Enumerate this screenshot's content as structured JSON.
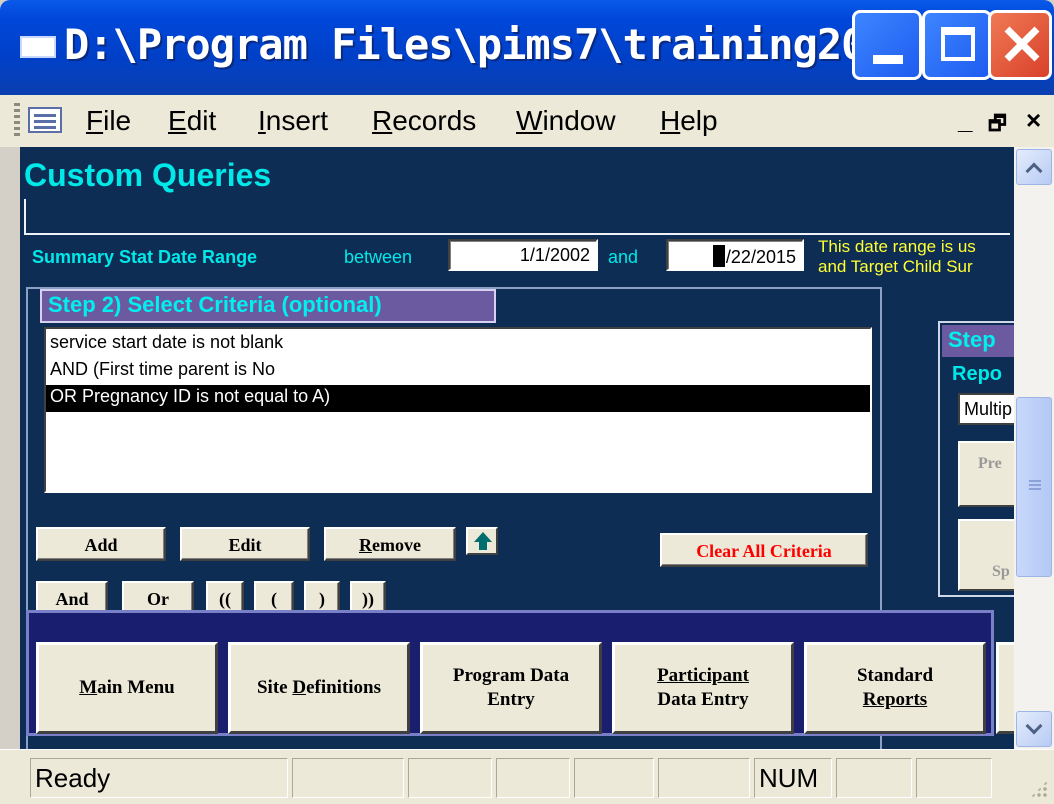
{
  "window": {
    "title": "D:\\Program Files\\pims7\\training20...",
    "buttons": [
      "minimize",
      "maximize",
      "close"
    ]
  },
  "menubar": {
    "items": [
      {
        "label": "File",
        "mnemonic": "F"
      },
      {
        "label": "Edit",
        "mnemonic": "E"
      },
      {
        "label": "Insert",
        "mnemonic": "I"
      },
      {
        "label": "Records",
        "mnemonic": "R"
      },
      {
        "label": "Window",
        "mnemonic": "W"
      },
      {
        "label": "Help",
        "mnemonic": "H"
      }
    ],
    "mdi_controls": {
      "minimize": "_",
      "restore": "🗗",
      "close": "×"
    }
  },
  "form": {
    "title": "Custom Queries",
    "date_range": {
      "label": "Summary Stat Date Range",
      "between": "between",
      "start": "1/1/2002",
      "and": "and",
      "end_rest": "/22/2015",
      "end_cursor_char": "2",
      "note_line1": "This date range is us",
      "note_line2": "and Target Child Sur"
    },
    "step2": {
      "title": "Step 2) Select Criteria (optional)",
      "criteria": [
        "service start date is not blank",
        "AND (First time parent is No",
        "OR Pregnancy ID is not equal to A)"
      ],
      "selected_index": 2,
      "buttons": {
        "add": "Add",
        "edit": "Edit",
        "remove": "Remove",
        "clear_all": "Clear All Criteria",
        "and": "And",
        "or": "Or",
        "open_double": "((",
        "open_single": "(",
        "close_single": ")",
        "close_double": "))"
      }
    },
    "step3": {
      "title": "Step",
      "sub": "Repo",
      "input": "Multip",
      "btn1": "Pre",
      "btn2": "Sp"
    },
    "nav": [
      {
        "line1": "Main Menu",
        "line2": ""
      },
      {
        "line1": "Site Definitions",
        "line2": ""
      },
      {
        "line1": "Program  Data",
        "line2": "Entry"
      },
      {
        "line1": "Participant",
        "line2": "Data Entry"
      },
      {
        "line1": "Standard",
        "line2": "Reports"
      }
    ]
  },
  "statusbar": {
    "status": "Ready",
    "num": "NUM"
  },
  "colors": {
    "form_bg": "#0e2d55",
    "cyan_text": "#00e8e8",
    "note_yellow": "#ffff33",
    "step_header": "#6b5aa0",
    "nav_bg": "#1a1e6e",
    "clear_red": "#ff0000"
  }
}
